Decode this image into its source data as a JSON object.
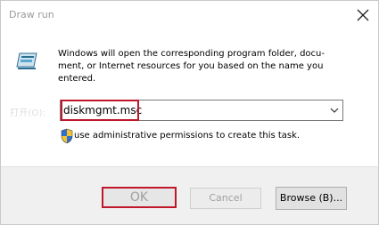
{
  "window": {
    "title": "Draw run"
  },
  "dialog": {
    "description": "Windows will open the corresponding program folder, docu-ment, or Internet resources for you based on the name you entered.",
    "open_label": "打开(O):",
    "command": {
      "value": "diskmgmt.msc"
    },
    "admin_note": "use administrative permissions to create this task."
  },
  "buttons": {
    "ok": "OK",
    "cancel": "Cancel",
    "browse": "Browse (B)..."
  },
  "colors": {
    "highlight": "#c0182a",
    "title": "#9a9a9a"
  },
  "icons": [
    "close-icon",
    "run-app-icon",
    "chevron-down-icon",
    "uac-shield-icon"
  ]
}
